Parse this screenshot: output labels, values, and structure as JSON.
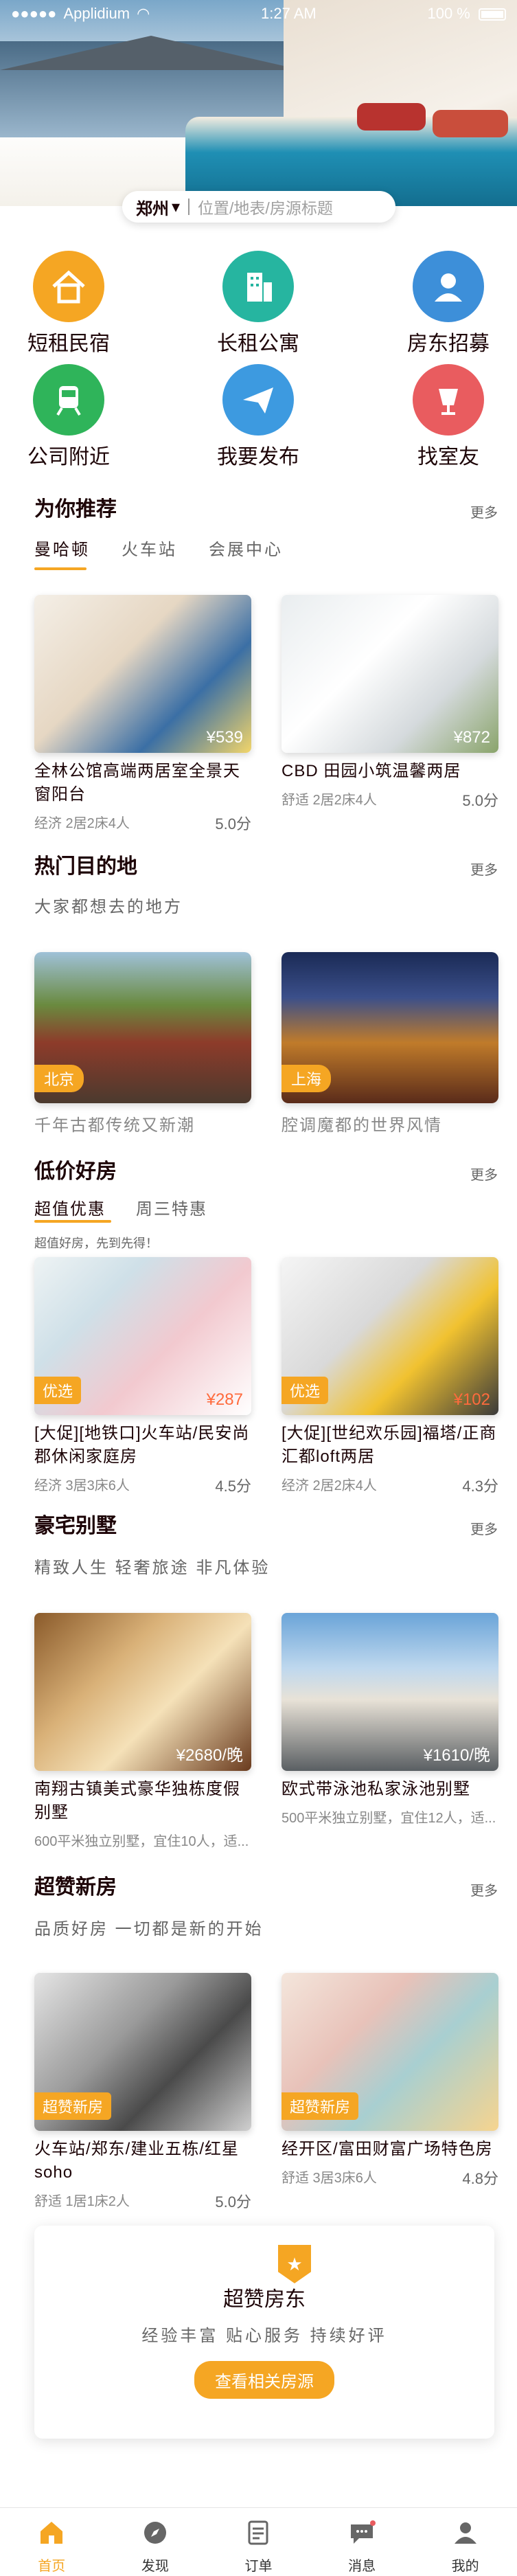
{
  "status": {
    "carrier": "Applidium",
    "time": "1:27 AM",
    "battery": "100 %"
  },
  "search": {
    "city": "郑州",
    "placeholder": "位置/地表/房源标题"
  },
  "categories": [
    {
      "label": "短租民宿",
      "color": "#f5a623",
      "icon": "house-icon"
    },
    {
      "label": "长租公寓",
      "color": "#26b5a0",
      "icon": "building-icon"
    },
    {
      "label": "房东招募",
      "color": "#3d8fd9",
      "icon": "person-icon"
    },
    {
      "label": "公司附近",
      "color": "#2fb45a",
      "icon": "train-icon"
    },
    {
      "label": "我要发布",
      "color": "#3d9ae0",
      "icon": "send-icon"
    },
    {
      "label": "找室友",
      "color": "#e95c5f",
      "icon": "cup-icon"
    }
  ],
  "recommend": {
    "title": "为你推荐",
    "more": "更多",
    "filters": [
      "曼哈顿",
      "火车站",
      "会展中心"
    ],
    "cards": [
      {
        "title": "全林公馆高端两居室全景天窗阳台",
        "price": "¥539",
        "meta": "经济 2居2床4人",
        "score": "5.0分"
      },
      {
        "title": "CBD 田园小筑温馨两居",
        "price": "¥872",
        "meta": "舒适 2居2床4人",
        "score": "5.0分"
      }
    ]
  },
  "hot": {
    "title": "热门目的地",
    "more": "更多",
    "subtitle": "大家都想去的地方",
    "places": [
      {
        "tag": "北京",
        "caption": "千年古都传统又新潮"
      },
      {
        "tag": "上海",
        "caption": "腔调魔都的世界风情"
      }
    ]
  },
  "cheap": {
    "title": "低价好房",
    "more": "更多",
    "tabs": [
      "超值优惠",
      "周三特惠"
    ],
    "note": "超值好房，先到先得！",
    "cards": [
      {
        "badge": "优选",
        "price": "¥287",
        "title": "[大促][地铁口]火车站/民安尚郡休闲家庭房",
        "meta": "经济 3居3床6人",
        "score": "4.5分"
      },
      {
        "badge": "优选",
        "price": "¥102",
        "title": "[大促][世纪欢乐园]福塔/正商汇都loft两居",
        "meta": "经济 2居2床4人",
        "score": "4.3分"
      }
    ]
  },
  "villa": {
    "title": "豪宅别墅",
    "more": "更多",
    "subtitle": "精致人生  轻奢旅途  非凡体验",
    "cards": [
      {
        "price": "¥2680/晚",
        "title": "南翔古镇美式豪华独栋度假别墅",
        "meta": "600平米独立别墅，宜住10人，适..."
      },
      {
        "price": "¥1610/晚",
        "title": "欧式带泳池私家泳池别墅",
        "meta": "500平米独立别墅，宜住12人，适..."
      }
    ]
  },
  "newhome": {
    "title": "超赞新房",
    "more": "更多",
    "subtitle": "品质好房  一切都是新的开始",
    "cards": [
      {
        "badge": "超赞新房",
        "title": "火车站/郑东/建业五栋/红星soho",
        "meta": "舒适 1居1床2人",
        "score": "5.0分"
      },
      {
        "badge": "超赞新房",
        "title": "经开区/富田财富广场特色房",
        "meta": "舒适 3居3床6人",
        "score": "4.8分"
      }
    ]
  },
  "promo": {
    "title": "超赞房东",
    "subtitle": "经验丰富  贴心服务  持续好评",
    "button": "查看相关房源"
  },
  "tabbar": [
    {
      "label": "首页",
      "icon": "home-icon",
      "active": true
    },
    {
      "label": "发现",
      "icon": "compass-icon",
      "active": false
    },
    {
      "label": "订单",
      "icon": "order-icon",
      "active": false
    },
    {
      "label": "消息",
      "icon": "message-icon",
      "active": false
    },
    {
      "label": "我的",
      "icon": "profile-icon",
      "active": false
    }
  ],
  "colors": {
    "accent": "#f5a623",
    "text": "#1d0407",
    "muted": "#888888"
  }
}
